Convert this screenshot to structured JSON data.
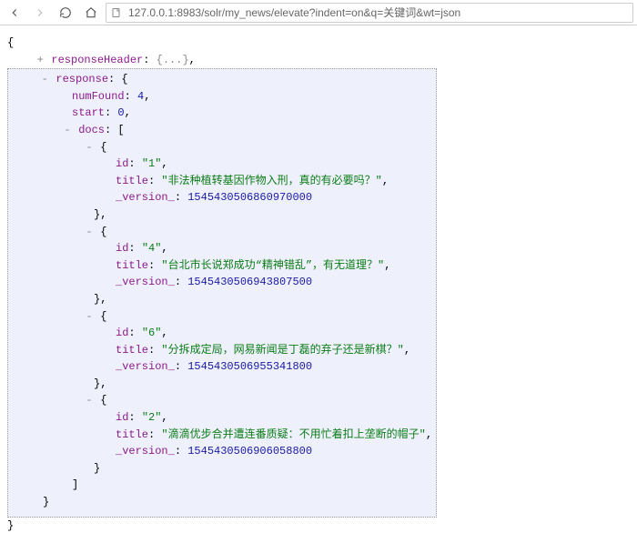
{
  "toolbar": {
    "url": "127.0.0.1:8983/solr/my_news/elevate?indent=on&q=关键词&wt=json"
  },
  "json_view": {
    "keys": {
      "responseHeader": "responseHeader",
      "response": "response",
      "numFound": "numFound",
      "start": "start",
      "docs": "docs",
      "id": "id",
      "title": "title",
      "version": "_version_"
    },
    "response": {
      "numFound": 4,
      "start": 0,
      "docs": [
        {
          "id": "1",
          "title": "非法种植转基因作物入刑，真的有必要吗？",
          "_version_": "1545430506860970000"
        },
        {
          "id": "4",
          "title": "台北市长说郑成功“精神错乱”，有无道理？",
          "_version_": "1545430506943807500"
        },
        {
          "id": "6",
          "title": "分拆成定局，网易新闻是丁磊的弃子还是新棋？",
          "_version_": "1545430506955341800"
        },
        {
          "id": "2",
          "title": "滴滴优步合并遭连番质疑：不用忙着扣上垄断的帽子",
          "_version_": "1545430506906058800"
        }
      ]
    },
    "collapsed_placeholder": "{...}"
  }
}
